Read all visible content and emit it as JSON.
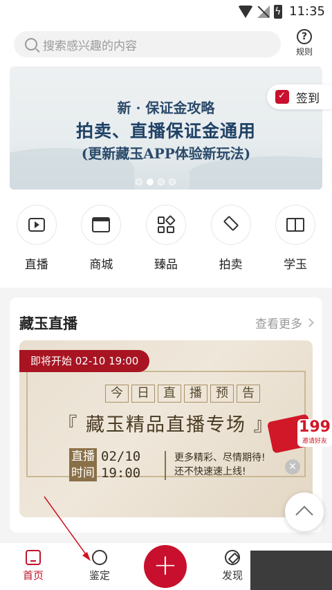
{
  "status_bar": {
    "time": "11:35"
  },
  "header": {
    "search_placeholder": "搜索感兴趣的内容",
    "rules_label": "规则"
  },
  "banner": {
    "line1": "新 · 保证金攻略",
    "line2": "拍卖、直播保证金通用",
    "line3": "(更新藏玉APP体验新玩法)",
    "signin_label": "签到",
    "pages": 4,
    "active_page": 2
  },
  "categories": [
    {
      "label": "直播",
      "icon": "tv-play-icon"
    },
    {
      "label": "商城",
      "icon": "shop-icon"
    },
    {
      "label": "臻品",
      "icon": "grid-diamond-icon"
    },
    {
      "label": "拍卖",
      "icon": "gavel-icon"
    },
    {
      "label": "学玉",
      "icon": "book-icon"
    }
  ],
  "live_section": {
    "title": "藏玉直播",
    "more_label": "查看更多",
    "poster": {
      "tag": "即将开始 02-10 19:00",
      "preview_chars": [
        "今",
        "日",
        "直",
        "播",
        "预",
        "告"
      ],
      "special_title": "『 藏玉精品直播专场 』",
      "date_key": "直播",
      "date_val": "02/10",
      "time_key": "时间",
      "time_val": "19:00",
      "slogan1": "更多精彩、尽情期待!",
      "slogan2": "还不快速速上线!"
    }
  },
  "red_packet": {
    "amount": "199",
    "sub": "邀请好友"
  },
  "bottom_nav": {
    "home": "首页",
    "appraise": "鉴定",
    "discover": "发现"
  },
  "colors": {
    "accent": "#c8102e",
    "banner_text": "#1f4166"
  }
}
